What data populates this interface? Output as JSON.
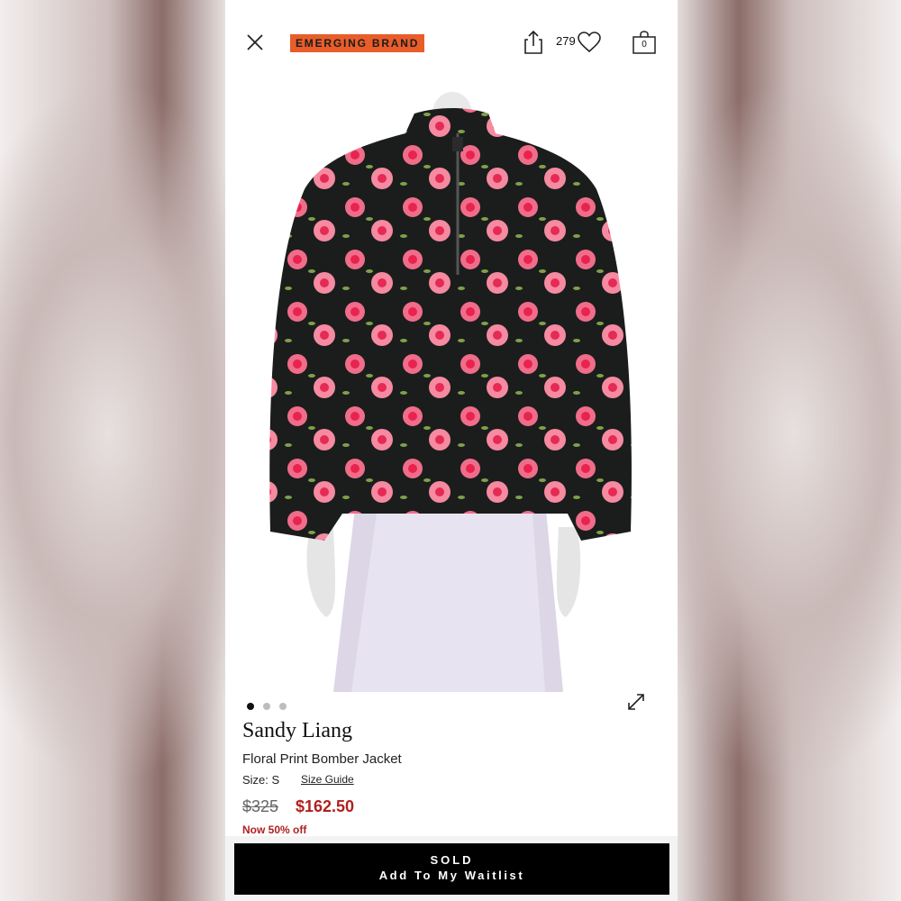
{
  "header": {
    "brand_badge": "EMERGING BRAND",
    "likes_count": "279",
    "bag_count": "0",
    "badge_color": "#e85d2a",
    "icons": [
      "close-icon",
      "share-icon",
      "heart-icon",
      "bag-icon"
    ]
  },
  "carousel": {
    "image_alt_icon": "product-image",
    "dot_count": 3,
    "active_index": 0,
    "expand_icon": "expand-icon"
  },
  "product": {
    "designer": "Sandy Liang",
    "title": "Floral Print Bomber Jacket",
    "size_label": "Size: S",
    "size_guide": "Size Guide",
    "original_price": "$325",
    "sale_price": "$162.50",
    "discount": "Now 50% off",
    "sale_color": "#b0201f"
  },
  "cta": {
    "status": "SOLD",
    "label": "Add To My Waitlist"
  }
}
